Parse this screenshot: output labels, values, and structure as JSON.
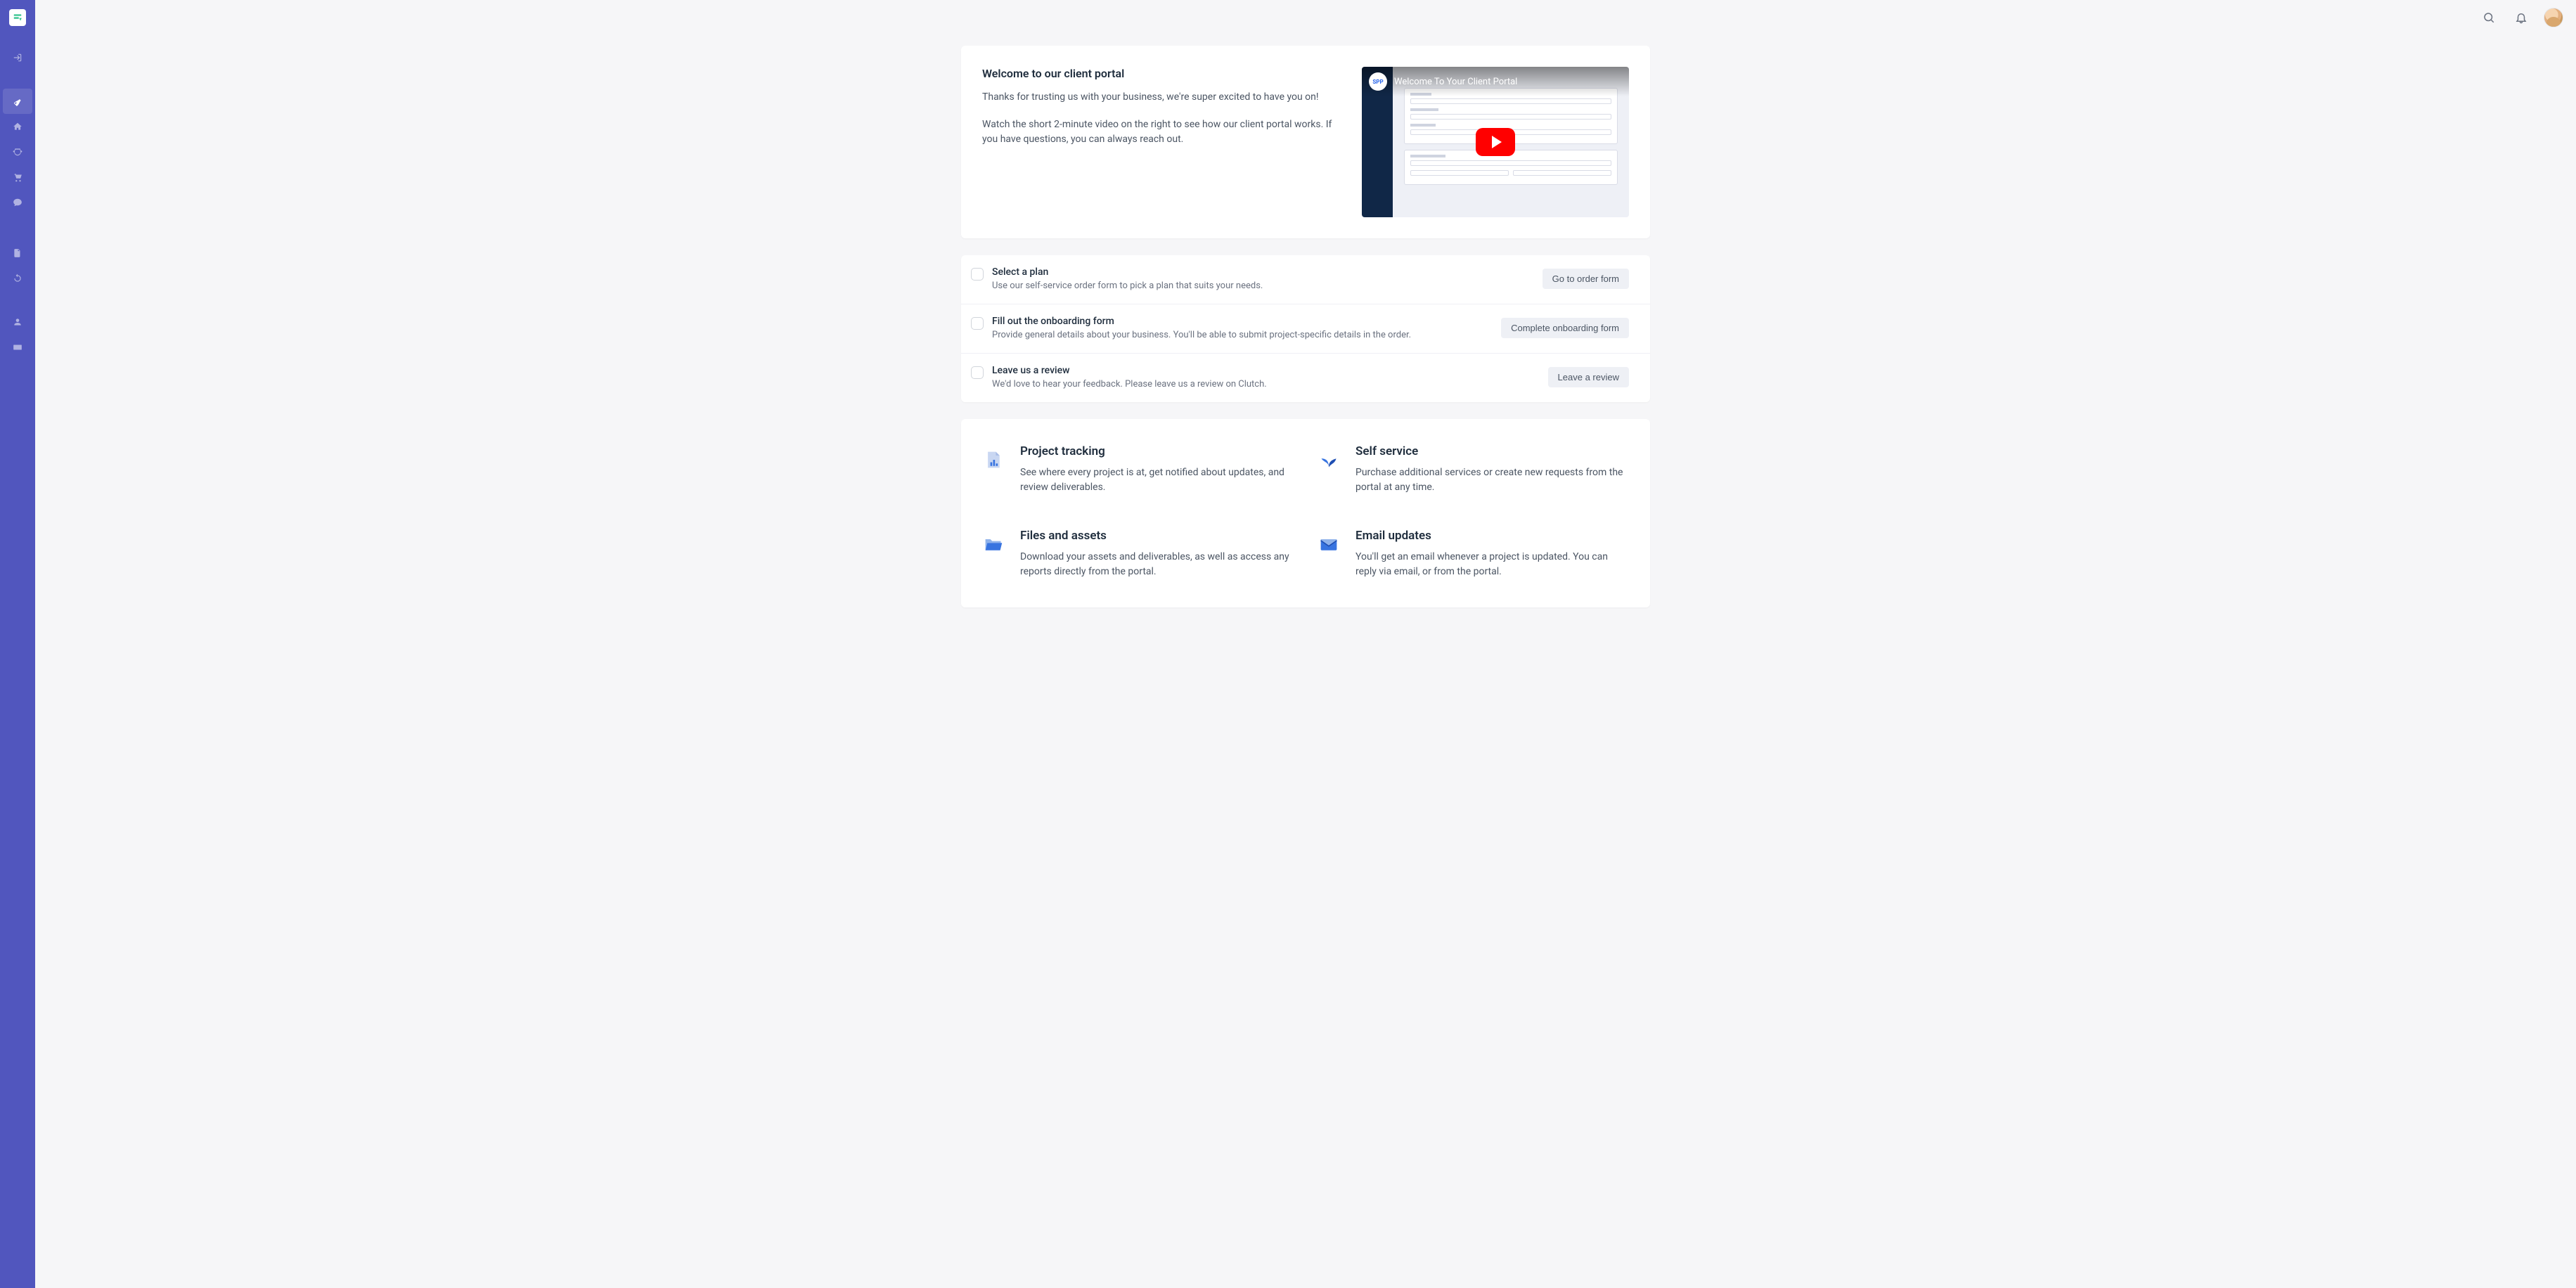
{
  "logo": {
    "text": "SP"
  },
  "video": {
    "title": "Welcome To Your Client Portal",
    "channel_badge": "SPP"
  },
  "welcome": {
    "title": "Welcome to our client portal",
    "para1": "Thanks for trusting us with your business, we're super excited to have you on!",
    "para2": "Watch the short 2-minute video on the right to see how our client portal works. If you have questions, you can always reach out."
  },
  "tasks": [
    {
      "title": "Select a plan",
      "desc": "Use our self-service order form to pick a plan that suits your needs.",
      "button": "Go to order form"
    },
    {
      "title": "Fill out the onboarding form",
      "desc": "Provide general details about your business. You'll be able to submit project-specific details in the order.",
      "button": "Complete onboarding form"
    },
    {
      "title": "Leave us a review",
      "desc": "We'd love to hear your feedback. Please leave us a review on Clutch.",
      "button": "Leave a review"
    }
  ],
  "features": [
    {
      "title": "Project tracking",
      "text": "See where every project is at, get notified about updates, and review deliverables."
    },
    {
      "title": "Self service",
      "text": "Purchase additional services or create new requests from the portal at any time."
    },
    {
      "title": "Files and assets",
      "text": "Download your assets and deliverables, as well as access any reports directly from the portal."
    },
    {
      "title": "Email updates",
      "text": "You'll get an email whenever a project is updated. You can reply via email, or from the portal."
    }
  ]
}
